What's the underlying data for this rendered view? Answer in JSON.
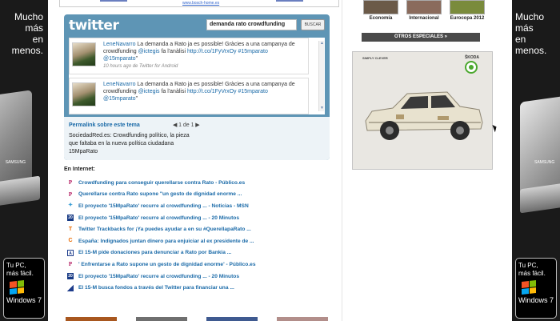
{
  "left_ad": {
    "slogan_line1": "Mucho más",
    "slogan_line2": "en menos.",
    "laptop_brand": "SAMSUNG",
    "badge_line1": "Tu PC,",
    "badge_line2": "más fácil.",
    "windows_label": "Windows 7"
  },
  "right_ad": {
    "slogan_line1": "Mucho más",
    "slogan_line2": "en menos.",
    "laptop_brand": "SAMSUNG",
    "badge_line1": "Tu PC,",
    "badge_line2": "más fácil.",
    "windows_label": "Windows 7"
  },
  "top_strip": {
    "url": "www.bosch-home.es"
  },
  "twitter": {
    "logo": "twitter",
    "search_value": "demanda rato crowdfunding",
    "search_button": "BUSCAR",
    "tweets": [
      {
        "user": "LeneNavarro",
        "text": " La demanda a Rato ja es possible! Gràcies a una campanya de crowdfunding ",
        "mention": "@ictegis",
        "text2": " fa l'anàlisi ",
        "link": "http://t.co/1FyVrxOy",
        "hashtag": " #15mparato",
        "handle": "@15mparato",
        "quote": "\"",
        "meta": "10 hours ago de Twitter for Android"
      },
      {
        "user": "LeneNavarro",
        "text": " La demanda a Rato ja es possible! Gràcies a una campanya de crowdfunding ",
        "mention": "@ictegis",
        "text2": " fa l'anàlisi ",
        "link": "http://t.co/1FyVrxOy",
        "hashtag": " #15mparato",
        "handle": "@15mparato",
        "quote": "\""
      }
    ],
    "permalink": "Permalink sobre este tema",
    "pager": "1 de 1",
    "description": "SociedadRed.es: Crowdfunding político, la pieza que faltaba en la nueva política ciudadana 15MpaRato"
  },
  "en_internet": {
    "title": "En Internet:",
    "items": [
      {
        "icon": "publico-icon",
        "glyph": "P",
        "text": "Crowdfunding para conseguir querellarse contra Rato - Público.es"
      },
      {
        "icon": "publico-icon",
        "glyph": "P",
        "text": "Querellarse contra Rato supone \"un gesto de dignidad enorme ..."
      },
      {
        "icon": "msn-icon",
        "glyph": "✦",
        "text": "El proyecto '15MpaRato' recurre al crowdfunding ... - Noticias - MSN"
      },
      {
        "icon": "20minutos-icon",
        "glyph": "20",
        "text": "El proyecto '15MpaRato' recurre al crowdfunding ... - 20 Minutos"
      },
      {
        "icon": "trackbacks-icon",
        "glyph": "T",
        "text": "Twitter Trackbacks for ¡Ya puedes ayudar a en su #QuerellapaRato ..."
      },
      {
        "icon": "ciudadano-icon",
        "glyph": "C",
        "text": "España: Indignados juntan dinero para enjuiciar al ex presidente de ..."
      },
      {
        "icon": "abc-icon",
        "glyph": "A",
        "text": "El 15-M pide donaciones para denunciar a Rato por Bankia ..."
      },
      {
        "icon": "publico-icon",
        "glyph": "P",
        "text": "' Enfrentarse a Rato supone un gesto de dignidad enorme' - Público.es"
      },
      {
        "icon": "20minutos-icon",
        "glyph": "20",
        "text": "El proyecto '15MpaRato' recurre al crowdfunding ... - 20 Minutos"
      },
      {
        "icon": "news-icon",
        "glyph": "",
        "text": "El 15-M busca fondos a través del Twitter para financiar una ..."
      }
    ]
  },
  "right_col": {
    "categories": [
      {
        "label": "Economía",
        "color": "#6b5a48"
      },
      {
        "label": "Internacional",
        "color": "#8a6b5c"
      },
      {
        "label": "Eurocopa 2012",
        "color": "#7a8b3c"
      }
    ],
    "otros": "OTROS ESPECIALES »",
    "skoda_tag": "SIMPLY CLEVER",
    "skoda_brand": "ŠKODA"
  }
}
